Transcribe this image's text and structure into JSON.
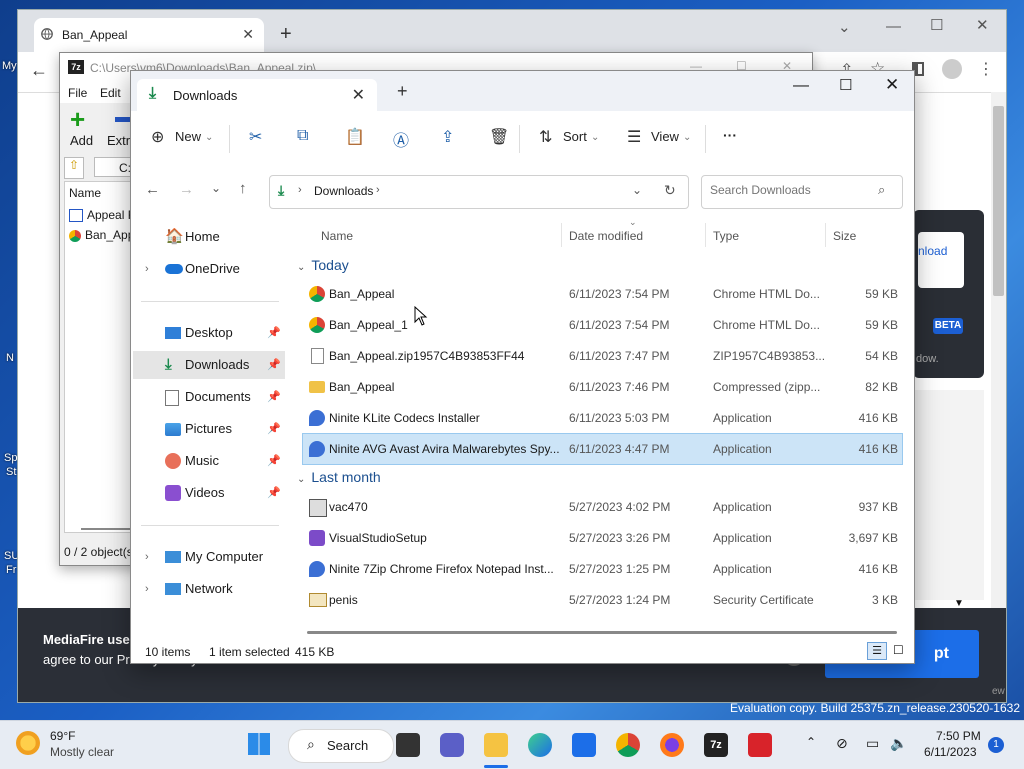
{
  "desktop": {
    "labels": [
      "My",
      "N",
      "Sp",
      "St",
      "SU",
      "Fr"
    ]
  },
  "chrome": {
    "tab_title": "Ban_Appeal",
    "mediafire_text": "MediaFire uses cookies... agree to our Privacy Policy.",
    "mediafire_line1": "MediaFire uses",
    "mediafire_line2": "agree to our Privacy Policy.",
    "accept_label": "pt",
    "download_label": "nload",
    "beta": "BETA",
    "dow_text": "dow.",
    "ew_text": "ew"
  },
  "zip": {
    "title": "C:\\Users\\vm6\\Downloads\\Ban_Appeal.zip\\",
    "menu": [
      "File",
      "Edit"
    ],
    "add_label": "Add",
    "extract_label": "Extra",
    "path": "C:",
    "col_name": "Name",
    "files": [
      "Appeal F",
      "Ban_App"
    ],
    "status": "0 / 2 object(s"
  },
  "explorer": {
    "tab_title": "Downloads",
    "cmd": {
      "new": "New",
      "sort": "Sort",
      "view": "View",
      "more": "···"
    },
    "breadcrumb": "Downloads",
    "search_placeholder": "Search Downloads",
    "nav": [
      {
        "label": "Home"
      },
      {
        "label": "OneDrive"
      },
      {
        "label": "Desktop"
      },
      {
        "label": "Downloads"
      },
      {
        "label": "Documents"
      },
      {
        "label": "Pictures"
      },
      {
        "label": "Music"
      },
      {
        "label": "Videos"
      },
      {
        "label": "My Computer"
      },
      {
        "label": "Network"
      }
    ],
    "columns": {
      "name": "Name",
      "date": "Date modified",
      "type": "Type",
      "size": "Size"
    },
    "groups": {
      "today": "Today",
      "last_month": "Last month"
    },
    "rows": [
      {
        "name": "Ban_Appeal",
        "date": "6/11/2023 7:54 PM",
        "type": "Chrome HTML Do...",
        "size": "59 KB",
        "icon": "chrome-icon"
      },
      {
        "name": "Ban_Appeal_1",
        "date": "6/11/2023 7:54 PM",
        "type": "Chrome HTML Do...",
        "size": "59 KB",
        "icon": "chrome-icon"
      },
      {
        "name": "Ban_Appeal.zip1957C4B93853FF44",
        "date": "6/11/2023 7:47 PM",
        "type": "ZIP1957C4B93853...",
        "size": "54 KB",
        "icon": "file-icon"
      },
      {
        "name": "Ban_Appeal",
        "date": "6/11/2023 7:46 PM",
        "type": "Compressed (zipp...",
        "size": "82 KB",
        "icon": "zip-folder-icon"
      },
      {
        "name": "Ninite KLite Codecs Installer",
        "date": "6/11/2023 5:03 PM",
        "type": "Application",
        "size": "416 KB",
        "icon": "ninite-icon"
      },
      {
        "name": "Ninite AVG Avast Avira Malwarebytes Spy...",
        "date": "6/11/2023 4:47 PM",
        "type": "Application",
        "size": "416 KB",
        "icon": "ninite-icon"
      },
      {
        "name": "vac470",
        "date": "5/27/2023 4:02 PM",
        "type": "Application",
        "size": "937 KB",
        "icon": "app-icon"
      },
      {
        "name": "VisualStudioSetup",
        "date": "5/27/2023 3:26 PM",
        "type": "Application",
        "size": "3,697 KB",
        "icon": "visual-studio-icon"
      },
      {
        "name": "Ninite 7Zip Chrome Firefox Notepad Inst...",
        "date": "5/27/2023 1:25 PM",
        "type": "Application",
        "size": "416 KB",
        "icon": "ninite-icon"
      },
      {
        "name": "penis",
        "date": "5/27/2023 1:24 PM",
        "type": "Security Certificate",
        "size": "3 KB",
        "icon": "certificate-icon"
      }
    ],
    "status": {
      "count": "10 items",
      "selected": "1 item selected",
      "size": "415 KB"
    }
  },
  "eval_text": "Evaluation copy. Build 25375.zn_release.230520-1632",
  "taskbar": {
    "weather_temp": "69°F",
    "weather_desc": "Mostly clear",
    "search_label": "Search",
    "time": "7:50 PM",
    "date": "6/11/2023",
    "notif_count": "1"
  }
}
